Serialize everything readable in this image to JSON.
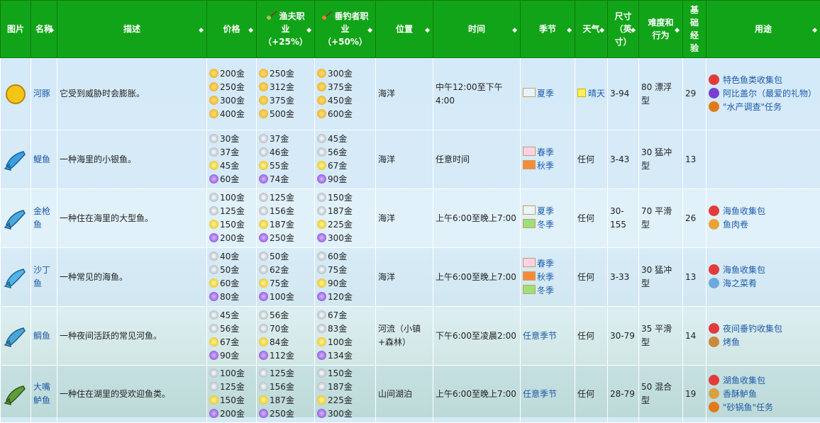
{
  "headers": {
    "image": "图片",
    "name": "名称",
    "desc": "描述",
    "price": "价格",
    "fisher_line1": "渔夫职",
    "fisher_line2": "业",
    "fisher_line3": "（+25%）",
    "angler_line1": "垂钓者职",
    "angler_line2": "业",
    "angler_line3": "（+50%）",
    "location": "位置",
    "time": "时间",
    "season": "季节",
    "weather": "天气",
    "size_line1": "尺寸",
    "size_line2": "（英",
    "size_line3": "寸）",
    "diff_line1": "难度和",
    "diff_line2": "行为",
    "xp_line1": "基",
    "xp_line2": "础",
    "xp_line3": "经",
    "xp_line4": "验",
    "use": "用途"
  },
  "rows": [
    {
      "name": "河豚",
      "icon": "pufferfish-icon",
      "desc": "它受到威胁时会膨胀。",
      "price": [
        "200金",
        "250金",
        "300金",
        "400金"
      ],
      "fisher": [
        "250金",
        "312金",
        "375金",
        "500金"
      ],
      "angler": [
        "300金",
        "375金",
        "450金",
        "600金"
      ],
      "location": "海洋",
      "time": "中午12:00至下午4:00",
      "seasons": [
        {
          "label": "夏季",
          "icon": "summer-icon"
        }
      ],
      "weather": "晴天",
      "size": "3-94",
      "diff": "80 漂浮型",
      "xp": "29",
      "uses": [
        {
          "label": "特色鱼类收集包",
          "icon": "bundle-icon"
        },
        {
          "label": "阿比盖尔（最爱的礼物）",
          "icon": "abigail-icon"
        },
        {
          "label": "\"水产调查\"任务",
          "icon": "quest-icon"
        }
      ]
    },
    {
      "name": "鳀鱼",
      "icon": "anchovy-icon",
      "desc": "一种海里的小银鱼。",
      "price": [
        "30金",
        "37金",
        "45金",
        "60金"
      ],
      "fisher": [
        "37金",
        "46金",
        "55金",
        "74金"
      ],
      "angler": [
        "45金",
        "56金",
        "67金",
        "90金"
      ],
      "location": "海洋",
      "time": "任意时间",
      "seasons": [
        {
          "label": "春季",
          "icon": "spring-icon"
        },
        {
          "label": "秋季",
          "icon": "fall-icon"
        }
      ],
      "weather": "任何",
      "size": "3-43",
      "diff": "30 猛冲型",
      "xp": "13",
      "uses": []
    },
    {
      "name": "金枪鱼",
      "icon": "tuna-icon",
      "desc": "一种住在海里的大型鱼。",
      "price": [
        "100金",
        "125金",
        "150金",
        "200金"
      ],
      "fisher": [
        "125金",
        "156金",
        "187金",
        "250金"
      ],
      "angler": [
        "150金",
        "187金",
        "225金",
        "300金"
      ],
      "location": "海洋",
      "time": "上午6:00至晚上7:00",
      "seasons": [
        {
          "label": "夏季",
          "icon": "summer-icon"
        },
        {
          "label": "冬季",
          "icon": "winter-icon"
        }
      ],
      "weather": "任何",
      "size": "30-155",
      "diff": "70 平滑型",
      "xp": "26",
      "uses": [
        {
          "label": "海鱼收集包",
          "icon": "bundle-icon"
        },
        {
          "label": "鱼肉卷",
          "icon": "fish-taco-icon"
        }
      ]
    },
    {
      "name": "沙丁鱼",
      "icon": "sardine-icon",
      "desc": "一种常见的海鱼。",
      "price": [
        "40金",
        "50金",
        "60金",
        "80金"
      ],
      "fisher": [
        "50金",
        "62金",
        "75金",
        "100金"
      ],
      "angler": [
        "60金",
        "75金",
        "90金",
        "120金"
      ],
      "location": "海洋",
      "time": "上午6:00至晚上7:00",
      "seasons": [
        {
          "label": "春季",
          "icon": "spring-icon"
        },
        {
          "label": "秋季",
          "icon": "fall-icon"
        },
        {
          "label": "冬季",
          "icon": "winter-icon"
        }
      ],
      "weather": "任何",
      "size": "3-33",
      "diff": "30 猛冲型",
      "xp": "13",
      "uses": [
        {
          "label": "海鱼收集包",
          "icon": "bundle-icon"
        },
        {
          "label": "海之菜肴",
          "icon": "dish-icon"
        }
      ]
    },
    {
      "name": "鲷鱼",
      "icon": "bream-icon",
      "desc": "一种夜间活跃的常见河鱼。",
      "price": [
        "45金",
        "56金",
        "67金",
        "90金"
      ],
      "fisher": [
        "56金",
        "70金",
        "84金",
        "112金"
      ],
      "angler": [
        "67金",
        "83金",
        "100金",
        "134金"
      ],
      "location": "河流（小镇+森林）",
      "time": "下午6:00至凌晨2:00",
      "seasons": [
        {
          "label": "任意季节",
          "icon": ""
        }
      ],
      "weather": "任何",
      "size": "30-79",
      "diff": "35 平滑型",
      "xp": "14",
      "uses": [
        {
          "label": "夜间垂钓收集包",
          "icon": "bundle-icon"
        },
        {
          "label": "烤鱼",
          "icon": "baked-fish-icon"
        }
      ]
    },
    {
      "name": "大嘴鲈鱼",
      "icon": "largemouth-bass-icon",
      "desc": "一种住在湖里的受欢迎鱼类。",
      "price": [
        "100金",
        "125金",
        "150金",
        "200金"
      ],
      "fisher": [
        "125金",
        "156金",
        "187金",
        "250金"
      ],
      "angler": [
        "150金",
        "187金",
        "225金",
        "300金"
      ],
      "location": "山间湖泊",
      "time": "上午6:00至晚上7:00",
      "seasons": [
        {
          "label": "任意季节",
          "icon": ""
        }
      ],
      "weather": "任何",
      "size": "28-79",
      "diff": "50 混合型",
      "xp": "19",
      "uses": [
        {
          "label": "湖鱼收集包",
          "icon": "bundle-icon"
        },
        {
          "label": "香酥鲈鱼",
          "icon": "crispy-bass-icon"
        },
        {
          "label": "\"砂锅鱼\"任务",
          "icon": "quest-icon"
        }
      ]
    }
  ]
}
